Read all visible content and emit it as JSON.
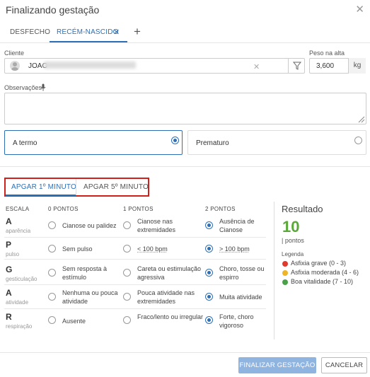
{
  "dialog": {
    "title": "Finalizando gestação"
  },
  "tabs": [
    {
      "label": "DESFECHO"
    },
    {
      "label": "RECÉM-NASCIDO"
    }
  ],
  "form": {
    "client_label": "Cliente",
    "client_value": "JOAO",
    "weight_label": "Peso na alta",
    "weight_value": "3,600",
    "weight_unit": "kg",
    "notes_label": "Observações"
  },
  "term_options": [
    {
      "label": "A termo",
      "selected": true
    },
    {
      "label": "Prematuro",
      "selected": false
    }
  ],
  "apgar_tabs": [
    {
      "label": "APGAR 1º MINUTO",
      "active": true
    },
    {
      "label": "APGAR 5º MINUTO",
      "active": false
    }
  ],
  "apgar_table": {
    "headers": [
      "ESCALA",
      "0 PONTOS",
      "1 PONTOS",
      "2 PONTOS"
    ],
    "rows": [
      {
        "letter": "A",
        "sub": "aparência",
        "opts": [
          "Cianose ou palidez",
          "Cianose nas extremidades",
          "Ausência de Cianose"
        ],
        "selected": 2
      },
      {
        "letter": "P",
        "sub": "pulso",
        "opts": [
          "Sem pulso",
          "< 100 bpm",
          "> 100 bpm"
        ],
        "selected": 2
      },
      {
        "letter": "G",
        "sub": "gesticulação",
        "opts": [
          "Sem resposta à estímulo",
          "Careta ou estimulação agressiva",
          "Choro, tosse ou espirro"
        ],
        "selected": 2
      },
      {
        "letter": "A",
        "sub": "atividade",
        "opts": [
          "Nenhuma ou pouca atividade",
          "Pouca atividade nas extremidades",
          "Muita atividade"
        ],
        "selected": 2
      },
      {
        "letter": "R",
        "sub": "respiração",
        "opts": [
          "Ausente",
          "Fraco/lento ou irregular",
          "Forte, choro vigoroso"
        ],
        "selected": 2
      }
    ]
  },
  "result": {
    "title": "Resultado",
    "score": "10",
    "unit": "| pontos",
    "score_color": "#5aa73a",
    "legend_title": "Legenda",
    "legend": [
      {
        "label": "Asfixia grave (0 - 3)",
        "color": "#e03a2f"
      },
      {
        "label": "Asfixia moderada (4 - 6)",
        "color": "#f0b429"
      },
      {
        "label": "Boa vitalidade (7 - 10)",
        "color": "#4aa14a"
      }
    ]
  },
  "footer": {
    "primary_label": "FINALIZAR GESTAÇÃO",
    "cancel_label": "CANCELAR"
  },
  "icons": {
    "close": "close-icon",
    "add": "plus-icon",
    "mic": "microphone-icon",
    "filter": "filter-icon",
    "avatar": "user-avatar-icon"
  }
}
